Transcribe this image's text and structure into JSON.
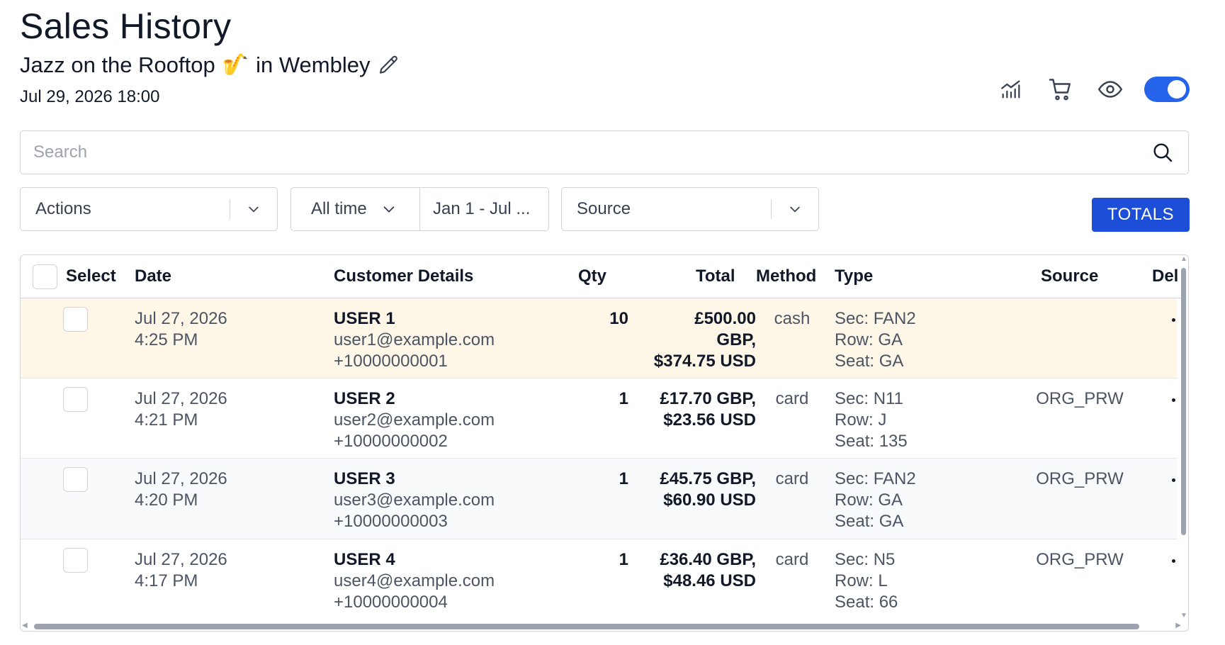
{
  "page": {
    "title": "Sales History",
    "event_name": "Jazz on the Rooftop",
    "event_emoji": "🎷",
    "event_venue": "in Wembley",
    "event_datetime": "Jul 29, 2026 18:00"
  },
  "toolbar": {
    "icons": [
      "chart-icon",
      "cart-icon",
      "eye-icon"
    ],
    "toggle_on": true,
    "accent_color": "#2563eb"
  },
  "search": {
    "placeholder": "Search",
    "value": ""
  },
  "filters": {
    "actions_label": "Actions",
    "time_range_label": "All time",
    "date_range_label": "Jan 1 - Jul ...",
    "source_label": "Source"
  },
  "totals_button": "TOTALS",
  "table": {
    "headers": {
      "select": "Select",
      "date": "Date",
      "customer": "Customer Details",
      "qty": "Qty",
      "total": "Total",
      "method": "Method",
      "type": "Type",
      "source": "Source",
      "del": "Del"
    },
    "rows": [
      {
        "date": "Jul 27, 2026",
        "time": "4:25 PM",
        "name": "USER 1",
        "email": "user1@example.com",
        "phone": "+10000000001",
        "qty": "10",
        "total_lines": [
          "£500.00",
          "GBP,",
          "$374.75 USD"
        ],
        "method": "cash",
        "sec": "Sec: FAN2",
        "row": "Row: GA",
        "seat": "Seat: GA",
        "source": ""
      },
      {
        "date": "Jul 27, 2026",
        "time": "4:21 PM",
        "name": "USER 2",
        "email": "user2@example.com",
        "phone": "+10000000002",
        "qty": "1",
        "total_lines": [
          "£17.70 GBP,",
          "$23.56 USD"
        ],
        "method": "card",
        "sec": "Sec: N11",
        "row": "Row: J",
        "seat": "Seat: 135",
        "source": "ORG_PRW"
      },
      {
        "date": "Jul 27, 2026",
        "time": "4:20 PM",
        "name": "USER 3",
        "email": "user3@example.com",
        "phone": "+10000000003",
        "qty": "1",
        "total_lines": [
          "£45.75 GBP,",
          "$60.90 USD"
        ],
        "method": "card",
        "sec": "Sec: FAN2",
        "row": "Row: GA",
        "seat": "Seat: GA",
        "source": "ORG_PRW"
      },
      {
        "date": "Jul 27, 2026",
        "time": "4:17 PM",
        "name": "USER 4",
        "email": "user4@example.com",
        "phone": "+10000000004",
        "qty": "1",
        "total_lines": [
          "£36.40 GBP,",
          "$48.46 USD"
        ],
        "method": "card",
        "sec": "Sec: N5",
        "row": "Row: L",
        "seat": "Seat: 66",
        "source": "ORG_PRW"
      }
    ]
  }
}
